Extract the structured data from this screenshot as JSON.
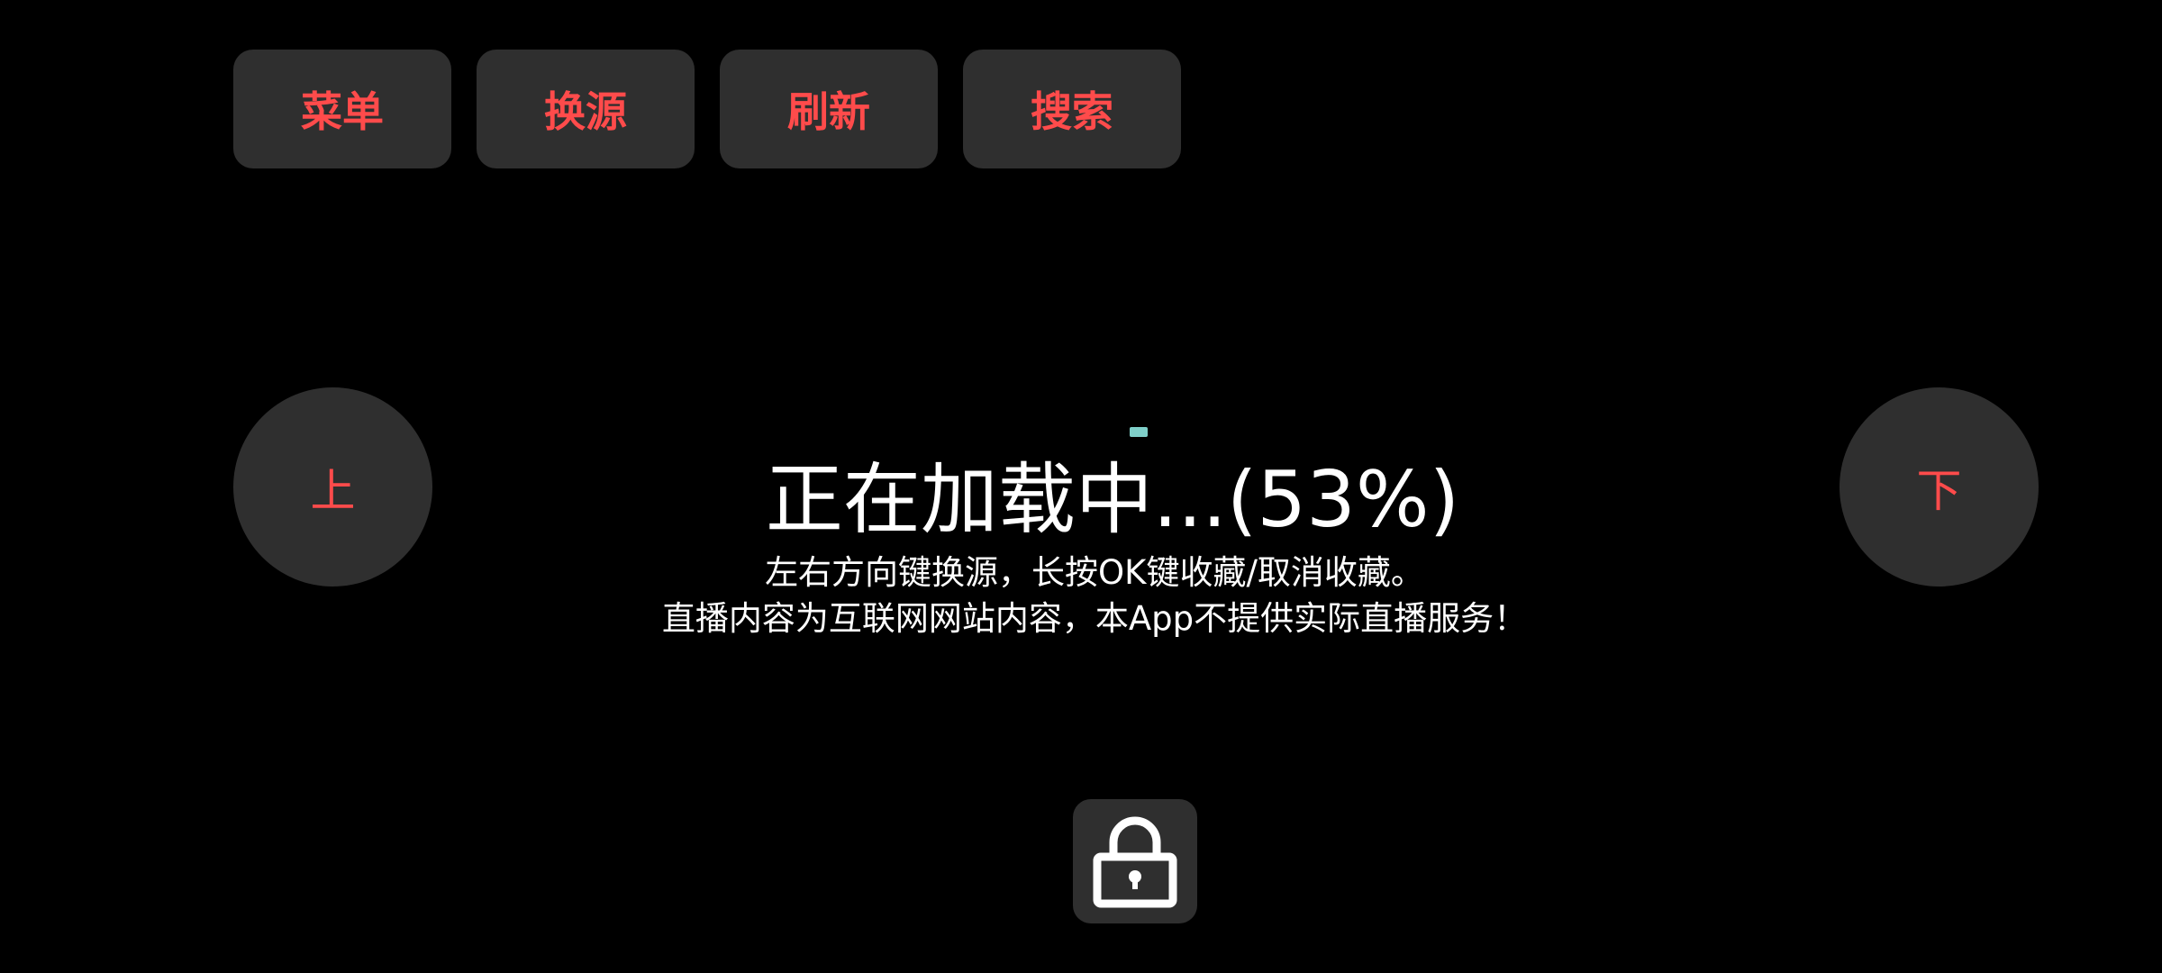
{
  "toolbar": {
    "menu_label": "菜单",
    "switch_source_label": "换源",
    "refresh_label": "刷新",
    "search_label": "搜索"
  },
  "channel_nav": {
    "up_label": "上",
    "down_label": "下"
  },
  "loading": {
    "title": "正在加载中...(53%)",
    "progress_percent": 53,
    "hint_line1": "左右方向键换源，长按OK键收藏/取消收藏。",
    "hint_line2": "直播内容为互联网网站内容，本App不提供实际直播服务！"
  },
  "lock": {
    "icon": "lock-icon"
  },
  "colors": {
    "background": "#000000",
    "button_bg": "#2f2f2f",
    "accent_red": "#ff4b4b",
    "spinner": "#7fcfc9",
    "text": "#ffffff"
  }
}
